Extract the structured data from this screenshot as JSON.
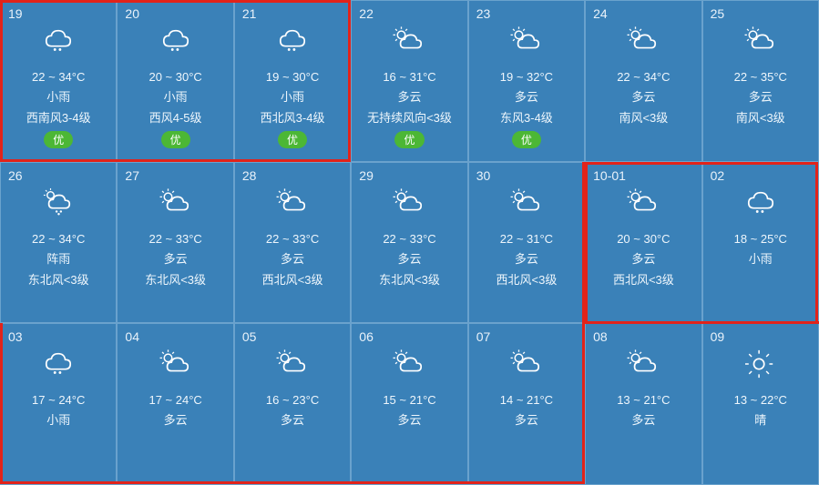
{
  "colors": {
    "bg": "#3a81b8",
    "border": "#6aa2cd",
    "text": "#eef6fc",
    "air": "#4cb735",
    "highlight": "#e2231a"
  },
  "air_label": "优",
  "cells": [
    {
      "day": "19",
      "icon": "light-rain",
      "temp": "22 ~ 34°C",
      "cond": "小雨",
      "wind": "西南风3-4级",
      "air": true
    },
    {
      "day": "20",
      "icon": "light-rain",
      "temp": "20 ~ 30°C",
      "cond": "小雨",
      "wind": "西风4-5级",
      "air": true
    },
    {
      "day": "21",
      "icon": "light-rain",
      "temp": "19 ~ 30°C",
      "cond": "小雨",
      "wind": "西北风3-4级",
      "air": true
    },
    {
      "day": "22",
      "icon": "partly-cloudy",
      "temp": "16 ~ 31°C",
      "cond": "多云",
      "wind": "无持续风向<3级",
      "air": true
    },
    {
      "day": "23",
      "icon": "partly-cloudy",
      "temp": "19 ~ 32°C",
      "cond": "多云",
      "wind": "东风3-4级",
      "air": true
    },
    {
      "day": "24",
      "icon": "partly-cloudy",
      "temp": "22 ~ 34°C",
      "cond": "多云",
      "wind": "南风<3级",
      "air": false
    },
    {
      "day": "25",
      "icon": "partly-cloudy",
      "temp": "22 ~ 35°C",
      "cond": "多云",
      "wind": "南风<3级",
      "air": false
    },
    {
      "day": "26",
      "icon": "shower",
      "temp": "22 ~ 34°C",
      "cond": "阵雨",
      "wind": "东北风<3级",
      "air": false
    },
    {
      "day": "27",
      "icon": "partly-cloudy",
      "temp": "22 ~ 33°C",
      "cond": "多云",
      "wind": "东北风<3级",
      "air": false
    },
    {
      "day": "28",
      "icon": "partly-cloudy",
      "temp": "22 ~ 33°C",
      "cond": "多云",
      "wind": "西北风<3级",
      "air": false
    },
    {
      "day": "29",
      "icon": "partly-cloudy",
      "temp": "22 ~ 33°C",
      "cond": "多云",
      "wind": "东北风<3级",
      "air": false
    },
    {
      "day": "30",
      "icon": "partly-cloudy",
      "temp": "22 ~ 31°C",
      "cond": "多云",
      "wind": "西北风<3级",
      "air": false
    },
    {
      "day": "10-01",
      "icon": "partly-cloudy",
      "temp": "20 ~ 30°C",
      "cond": "多云",
      "wind": "西北风<3级",
      "air": false
    },
    {
      "day": "02",
      "icon": "light-rain",
      "temp": "18 ~ 25°C",
      "cond": "小雨",
      "wind": "",
      "air": false
    },
    {
      "day": "03",
      "icon": "light-rain",
      "temp": "17 ~ 24°C",
      "cond": "小雨",
      "wind": "",
      "air": false
    },
    {
      "day": "04",
      "icon": "partly-cloudy",
      "temp": "17 ~ 24°C",
      "cond": "多云",
      "wind": "",
      "air": false
    },
    {
      "day": "05",
      "icon": "partly-cloudy",
      "temp": "16 ~ 23°C",
      "cond": "多云",
      "wind": "",
      "air": false
    },
    {
      "day": "06",
      "icon": "partly-cloudy",
      "temp": "15 ~ 21°C",
      "cond": "多云",
      "wind": "",
      "air": false
    },
    {
      "day": "07",
      "icon": "partly-cloudy",
      "temp": "14 ~ 21°C",
      "cond": "多云",
      "wind": "",
      "air": false
    },
    {
      "day": "08",
      "icon": "partly-cloudy",
      "temp": "13 ~ 21°C",
      "cond": "多云",
      "wind": "",
      "air": false
    },
    {
      "day": "09",
      "icon": "sunny",
      "temp": "13 ~ 22°C",
      "cond": "晴",
      "wind": "",
      "air": false
    }
  ]
}
